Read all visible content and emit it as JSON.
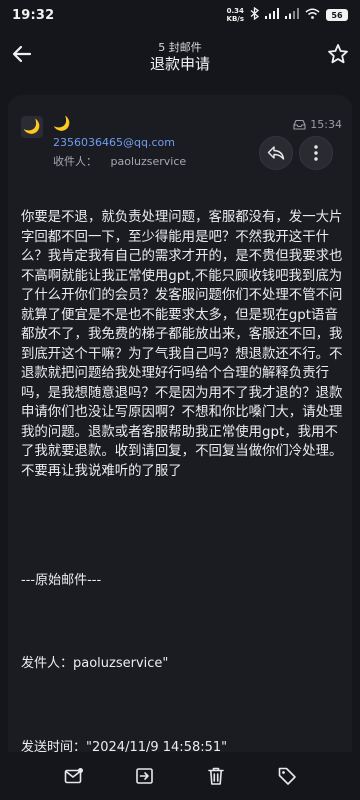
{
  "status_bar": {
    "time": "19:32",
    "net_speed_value": "0.34",
    "net_speed_unit": "KB/s",
    "battery": "56"
  },
  "header": {
    "count": "5 封邮件",
    "title": "退款申请"
  },
  "email": {
    "sender_name": "🌙",
    "sender_avatar": "🌙",
    "sender_email": "2356036465@qq.com",
    "recipient_label": "收件人：",
    "recipient": "paoluzservice",
    "time": "15:34",
    "body": "你要是不退，就负责处理问题，客服都没有，发一大片字回都不回一下，至少得能用是吧？不然我开这干什么？我肯定我有自己的需求才开的，是不贵但我要求也不高啊就能让我正常使用gpt,不能只顾收钱吧我到底为了什么开你们的会员？发客服问题你们不处理不管不问就算了便宜是不是也不能要求太多，但是现在gpt语音都放不了，我免费的梯子都能放出来，客服还不回，我到底开这个干嘛？为了气我自己吗？想退款还不行。不退款就把问题给我处理好行吗给个合理的解释负责行吗，是我想随意退吗？不是因为用不了我才退的？退款申请你们也没让写原因啊？不想和你比嗓门大，请处理我的问题。退款或者客服帮助我正常使用gpt，我用不了我就要退款。收到请回复，不回复当做你们冷处理。不要再让我说难听的了服了",
    "original_header": "---原始邮件---",
    "from_line": "发件人：paoluzservice\"",
    "sent_line": "发送时间：\"2024/11/9 14:58:51\""
  },
  "icons": {
    "back": "arrow-left-icon",
    "star": "star-icon",
    "reply": "reply-icon",
    "more": "more-vertical-icon",
    "time": "inbox-icon",
    "bottom": [
      "mark-unread-icon",
      "move-icon",
      "delete-icon",
      "tag-icon"
    ]
  }
}
